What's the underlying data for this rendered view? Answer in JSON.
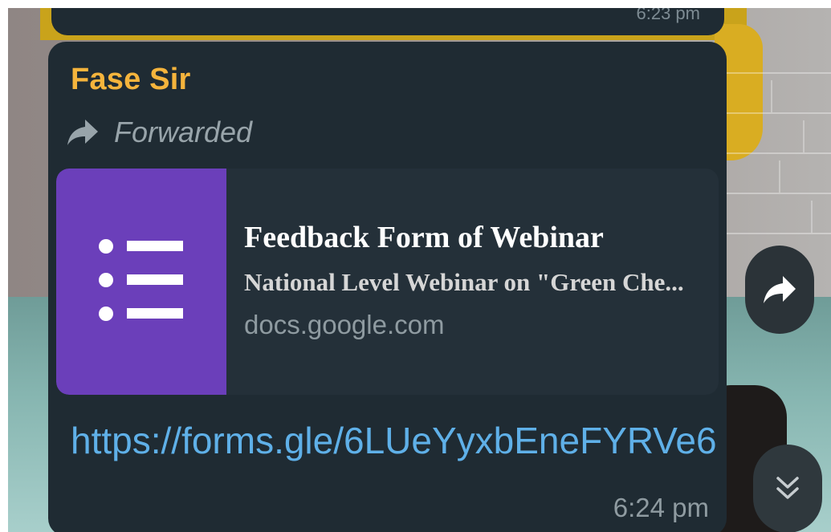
{
  "previous_message": {
    "time": "6:23 pm"
  },
  "message": {
    "sender": "Fase Sir",
    "forwarded_label": "Forwarded",
    "link_preview": {
      "title": "Feedback Form of Webinar",
      "description": "National Level Webinar on \"Green Che...",
      "domain": "docs.google.com"
    },
    "link": "https://forms.gle/6LUeYyxbEneFYRVe6",
    "time": "6:24 pm"
  },
  "icons": {
    "forward": "share-forward-icon",
    "scroll_down": "chevron-double-down-icon",
    "form": "google-forms-list-icon"
  },
  "colors": {
    "bubble": "#1f2b33",
    "sender": "#f5b43c",
    "link": "#5fb0e8",
    "forms_purple": "#6b3fba"
  }
}
